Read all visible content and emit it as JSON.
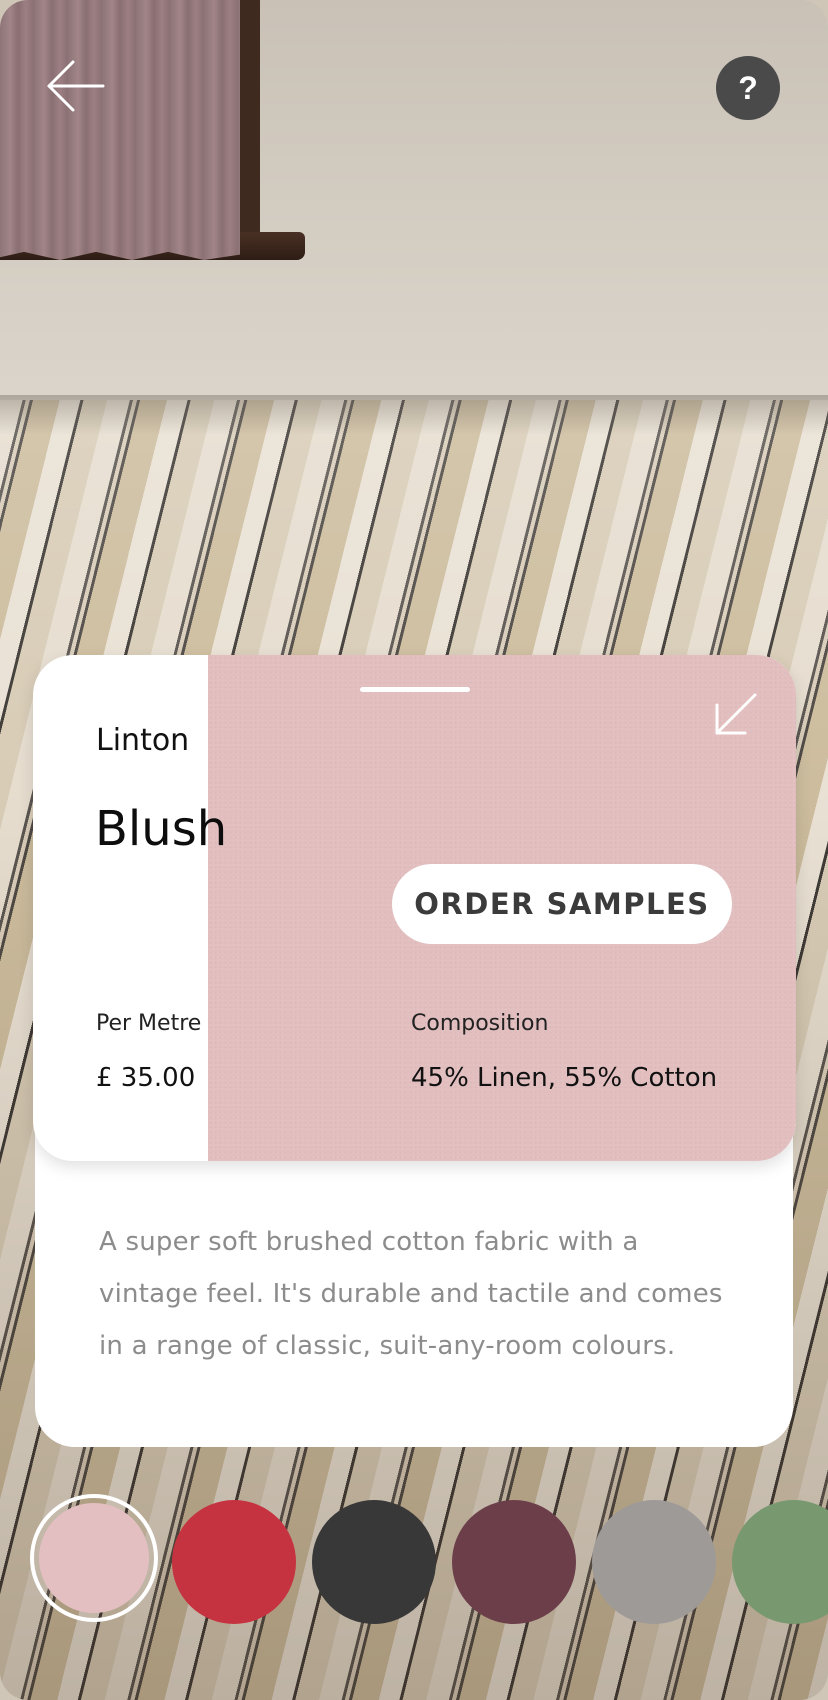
{
  "header": {
    "back_icon": "arrow-left-icon",
    "help_label": "?"
  },
  "product": {
    "collection": "Linton",
    "colour_name": "Blush",
    "order_button_label": "ORDER SAMPLES",
    "collapse_icon": "arrow-down-left-icon",
    "per_metre_label": "Per Metre",
    "price": "£ 35.00",
    "composition_label": "Composition",
    "composition_value": "45% Linen, 55% Cotton",
    "description": "A super soft brushed cotton fabric with a vintage feel. It's durable and tactile and comes in a range of classic, suit-any-room colours.",
    "swatch_color": "#e2bebf"
  },
  "swatches": [
    {
      "name": "blush",
      "color": "#e4bfc1",
      "selected": true
    },
    {
      "name": "red",
      "color": "#c63340",
      "selected": false
    },
    {
      "name": "charcoal",
      "color": "#383838",
      "selected": false
    },
    {
      "name": "plum",
      "color": "#6c3e4a",
      "selected": false
    },
    {
      "name": "grey",
      "color": "#9e9a98",
      "selected": false
    },
    {
      "name": "sage",
      "color": "#789870",
      "selected": false
    }
  ]
}
